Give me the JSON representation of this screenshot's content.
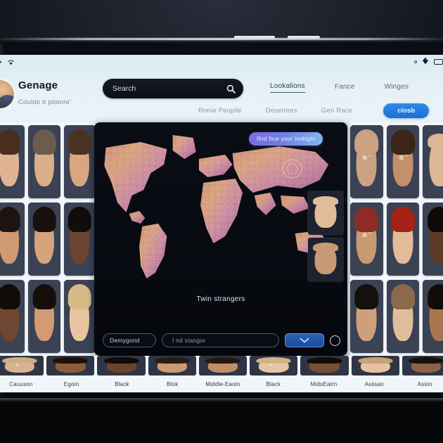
{
  "status_bar": {
    "left_icons": [
      "signal-icon",
      "wifi-icon"
    ],
    "right_icons": [
      "dot-icon",
      "location-icon",
      "battery-icon"
    ]
  },
  "header": {
    "brand_title": "Genage",
    "brand_subtitle": "Coulde b plotore'",
    "avatar_name": "user-avatar"
  },
  "search": {
    "placeholder": "Search",
    "icon": "search-icon"
  },
  "nav_primary": [
    {
      "label": "Lookalions",
      "active": true
    },
    {
      "label": "Fance",
      "active": false
    },
    {
      "label": "Winges",
      "active": false
    }
  ],
  "nav_secondary": [
    {
      "label": "Ronie Peuplle"
    },
    {
      "label": "Desentors"
    },
    {
      "label": "Gen Race"
    }
  ],
  "cta": {
    "label": "closb"
  },
  "map_panel": {
    "badge": "Ifnd ficw your lookigni",
    "caption": "Twin strangers",
    "filter_pill": "Demygond",
    "search_placeholder": "I nd stangor",
    "dropdown_icon": "chevron-down-icon",
    "toggle_icon": "circle-toggle-icon",
    "side_faces": [
      "side-face-1",
      "side-face-2"
    ]
  },
  "grid_left": [
    [
      {
        "skin": "#e0b392",
        "hair": "#4a2d1c",
        "style": "plain"
      },
      {
        "skin": "#d9ae8b",
        "hair": "#6b5c4e",
        "style": "plain"
      },
      {
        "skin": "#d8a67f",
        "hair": "#4b3324",
        "style": "plain"
      }
    ],
    [
      {
        "skin": "#cf9a72",
        "hair": "#1d1410",
        "style": "plain"
      },
      {
        "skin": "#d6a37c",
        "hair": "#17110d",
        "style": "plain"
      },
      {
        "skin": "#6b4530",
        "hair": "#120d0a",
        "style": "plain"
      }
    ],
    [
      {
        "skin": "#6e4631",
        "hair": "#120c09",
        "style": "plain"
      },
      {
        "skin": "#d29b74",
        "hair": "#150f0b",
        "style": "plain"
      },
      {
        "skin": "#e8c6a4",
        "hair": "#d7bb86",
        "style": "plain"
      }
    ]
  ],
  "grid_right": [
    [
      {
        "skin": "#cba184",
        "hair": "#cba184",
        "style": "textured"
      },
      {
        "skin": "#c3906c",
        "hair": "#3b2418",
        "style": "textured"
      },
      {
        "skin": "#ddb793",
        "hair": "#ddb793",
        "style": "bald"
      }
    ],
    [
      {
        "skin": "#c79a74",
        "hair": "#8d2b24",
        "style": "textured"
      },
      {
        "skin": "#e3bb9a",
        "hair": "#a32218",
        "style": "plain"
      },
      {
        "skin": "#5b3a28",
        "hair": "#0f0a07",
        "style": "plain"
      }
    ],
    [
      {
        "skin": "#cf9f7c",
        "hair": "#14100d",
        "style": "plain"
      },
      {
        "skin": "#e2bd9c",
        "hair": "#8a6a4a",
        "style": "plain"
      },
      {
        "skin": "#a9764f",
        "hair": "#110c09",
        "style": "plain"
      }
    ]
  ],
  "bottom_row": [
    {
      "label": "Cauuson",
      "skin": "#d9b294",
      "hair": "#cfae85",
      "style": "textured"
    },
    {
      "label": "Egoin",
      "skin": "#8a5c3c",
      "hair": "#1a110b",
      "style": "plain"
    },
    {
      "label": "Black",
      "skin": "#6a432d",
      "hair": "#110b08",
      "style": "plain"
    },
    {
      "label": "Blok",
      "skin": "#c99a74",
      "hair": "#2a1a11",
      "style": "plain"
    },
    {
      "label": "Middle-Eaotn",
      "skin": "#c08d66",
      "hair": "#241710",
      "style": "plain"
    },
    {
      "label": "Black",
      "skin": "#e6c5a6",
      "hair": "#d3b285",
      "style": "textured"
    },
    {
      "label": "MidsEatrn",
      "skin": "#7a4e34",
      "hair": "#120c08",
      "style": "plain"
    },
    {
      "label": "Asiisan",
      "skin": "#e5c3a2",
      "hair": "#c9a177",
      "style": "plain"
    },
    {
      "label": "Asion",
      "skin": "#8e6044",
      "hair": "#161009",
      "style": "plain"
    }
  ],
  "colors": {
    "accent_blue": "#2f8ae8",
    "badge_purple": "#7a6ce0",
    "screen_bg": "#e7f2f7",
    "panel_dark": "#070a10"
  }
}
